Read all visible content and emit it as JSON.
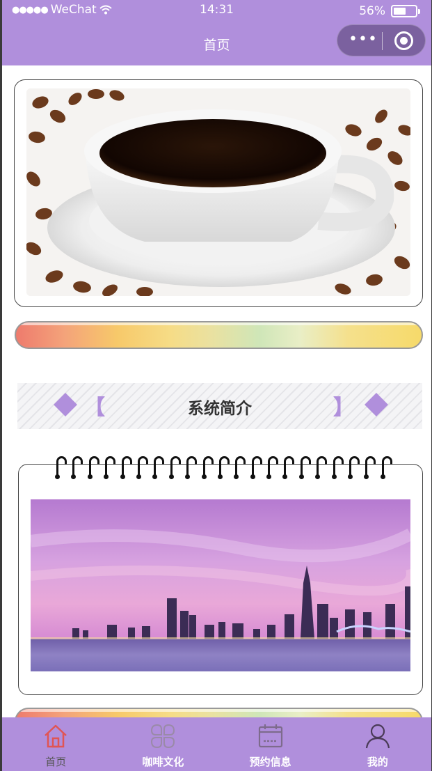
{
  "status_bar": {
    "carrier": "WeChat",
    "time": "14:31",
    "battery": "56%",
    "battery_level": 0.56
  },
  "nav": {
    "title": "首页",
    "capsule_more": "•••"
  },
  "intro_section": {
    "title": "系统简介",
    "bracket_left": "【",
    "bracket_right": "】"
  },
  "tabs": [
    {
      "label": "首页",
      "icon": "home-icon",
      "active": true
    },
    {
      "label": "咖啡文化",
      "icon": "grid-icon",
      "active": false
    },
    {
      "label": "预约信息",
      "icon": "calendar-icon",
      "active": false
    },
    {
      "label": "我的",
      "icon": "user-icon",
      "active": false
    }
  ],
  "colors": {
    "accent": "#b08fdc",
    "active_tab_icon": "#e05555"
  }
}
